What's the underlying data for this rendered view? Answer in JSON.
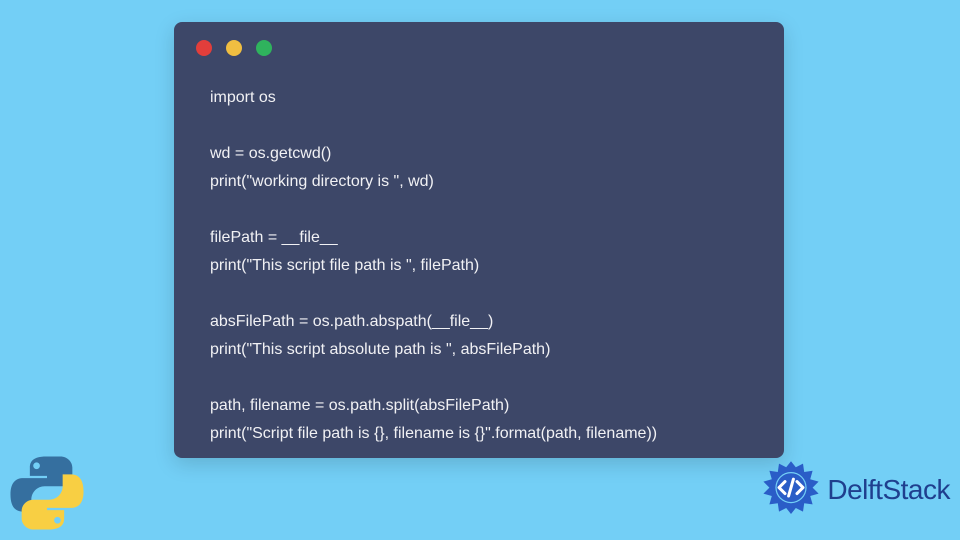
{
  "code_lines": [
    "import os",
    "",
    "wd = os.getcwd()",
    "print(\"working directory is \", wd)",
    "",
    "filePath = __file__",
    "print(\"This script file path is \", filePath)",
    "",
    "absFilePath = os.path.abspath(__file__)",
    "print(\"This script absolute path is \", absFilePath)",
    "",
    "path, filename = os.path.split(absFilePath)",
    "print(\"Script file path is {}, filename is {}\".format(path, filename))"
  ],
  "brand": {
    "name": "DelftStack"
  },
  "colors": {
    "background": "#73cff6",
    "window": "#3d4768",
    "text": "#f1f1f4",
    "brand_blue": "#1f3f8e",
    "badge_blue": "#2a5dc7",
    "python_blue": "#356f9f",
    "python_yellow": "#f8cf43"
  }
}
